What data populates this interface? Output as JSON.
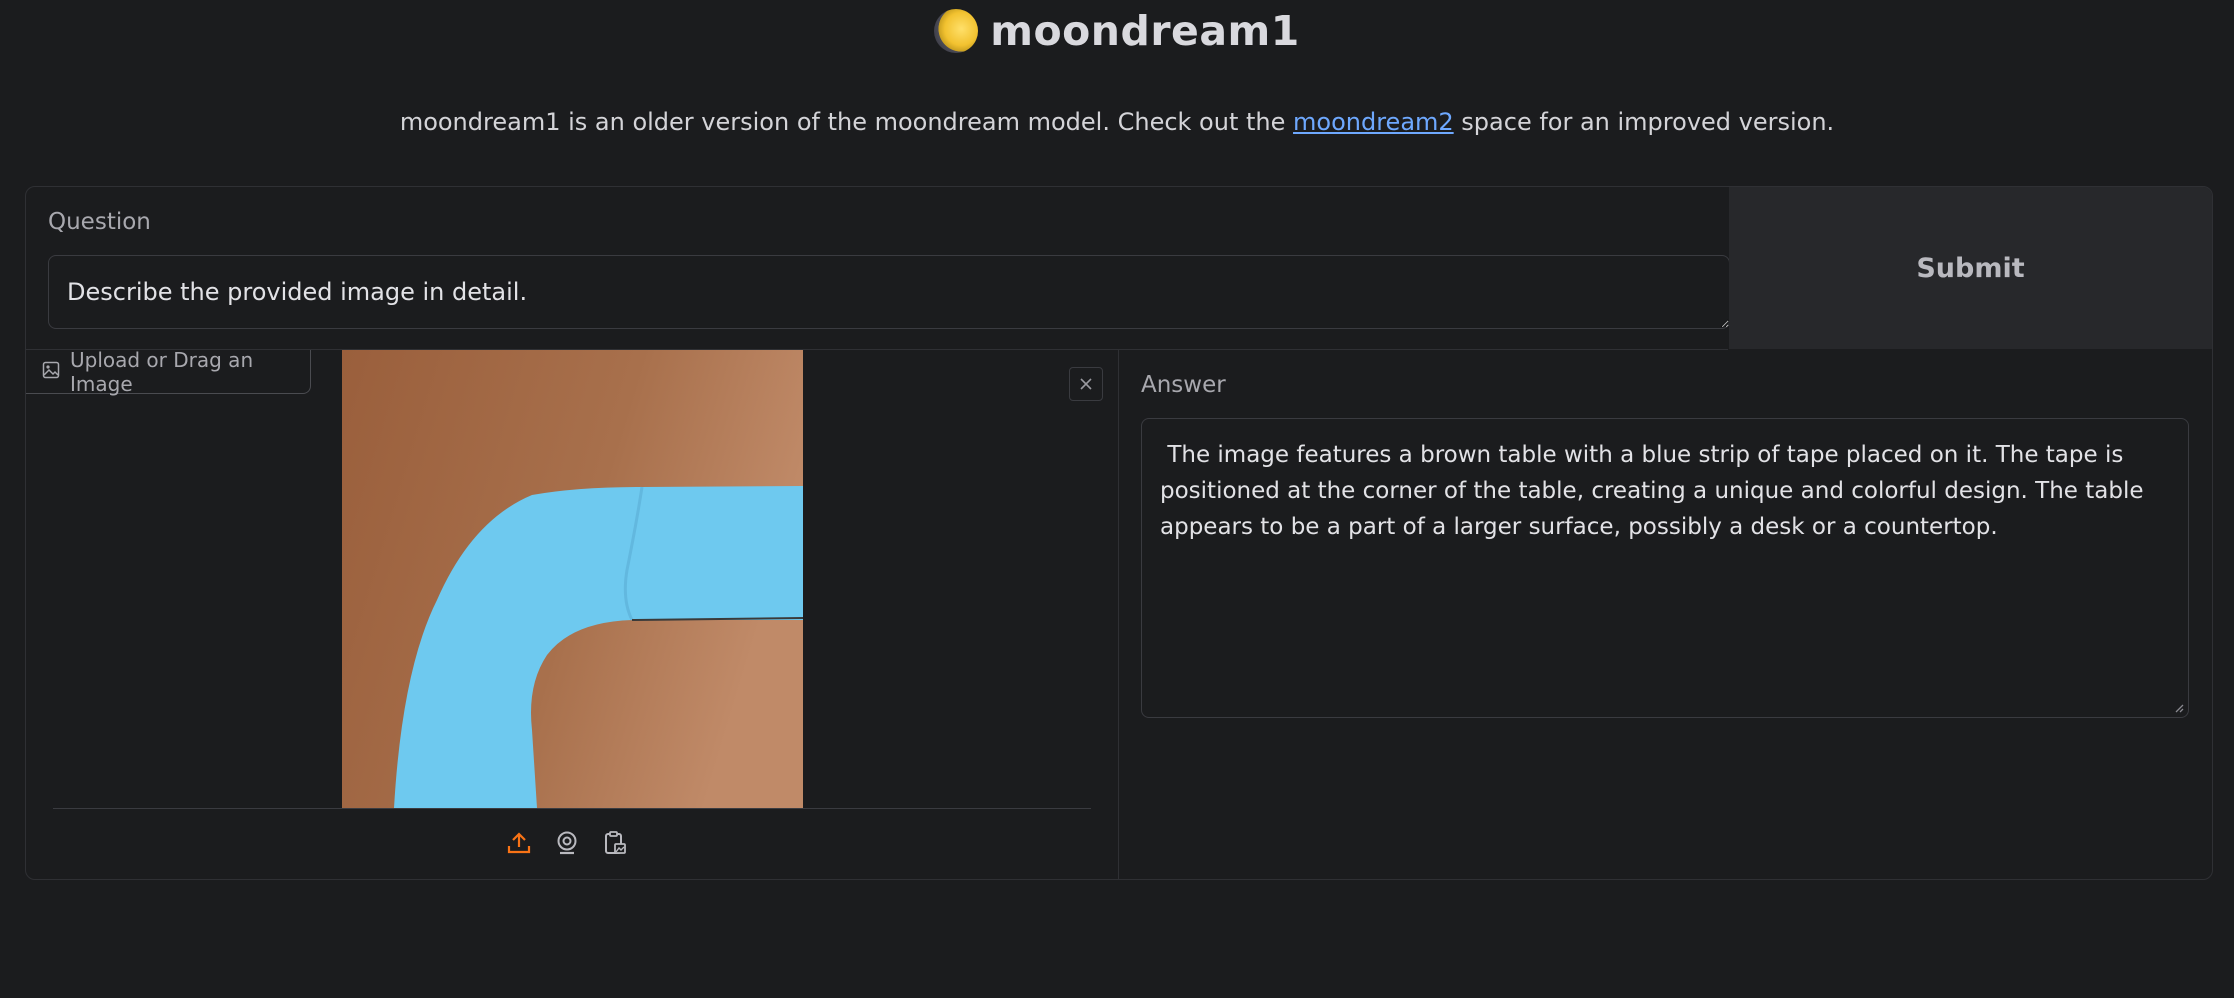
{
  "header": {
    "title": "moondream1",
    "logo_icon": "moon-icon"
  },
  "description": {
    "before": "moondream1 is an older version of the moondream model. Check out the ",
    "link": "moondream2",
    "after": " space for an improved version."
  },
  "question": {
    "label": "Question",
    "value": "Describe the provided image in detail."
  },
  "submit": {
    "label": "Submit"
  },
  "image_input": {
    "label": "Upload or Drag an Image",
    "source_icons": [
      "upload-icon",
      "webcam-icon",
      "clipboard-icon"
    ]
  },
  "answer": {
    "label": "Answer",
    "text": " The image features a brown table with a blue strip of tape placed on it. The tape is positioned at the corner of the table, creating a unique and colorful design. The table appears to be a part of a larger surface, possibly a desk or a countertop."
  },
  "colors": {
    "background": "#1b1c1e",
    "link": "#6ea8fe",
    "accent_upload": "#f97316",
    "submit_bg": "#27282b"
  }
}
